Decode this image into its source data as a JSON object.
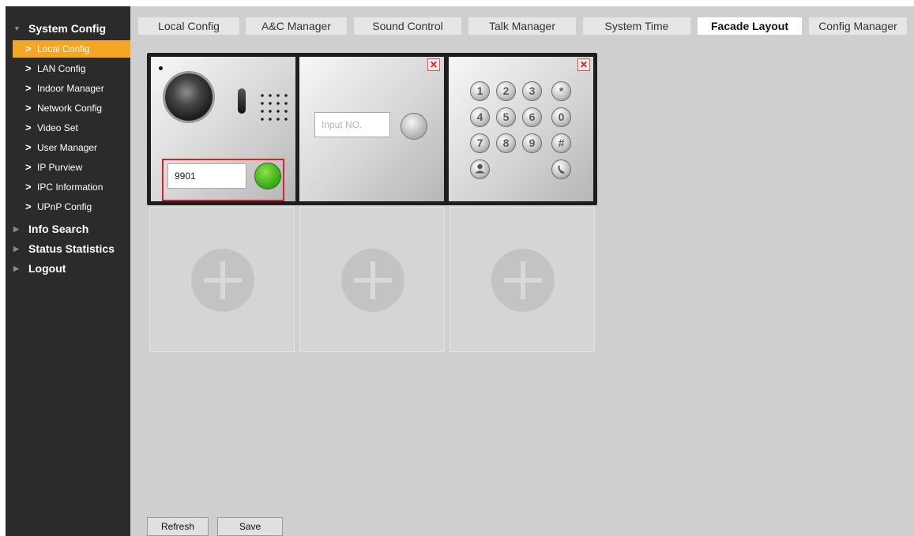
{
  "sidebar": {
    "system_config": "System Config",
    "items": [
      {
        "label": "Local Config"
      },
      {
        "label": "LAN Config"
      },
      {
        "label": "Indoor Manager"
      },
      {
        "label": "Network Config"
      },
      {
        "label": "Video Set"
      },
      {
        "label": "User Manager"
      },
      {
        "label": "IP Purview"
      },
      {
        "label": "IPC Information"
      },
      {
        "label": "UPnP Config"
      }
    ],
    "info_search": "Info Search",
    "status_statistics": "Status Statistics",
    "logout": "Logout",
    "active_item": "Local Config"
  },
  "tabs": [
    {
      "label": "Local Config"
    },
    {
      "label": "A&C Manager"
    },
    {
      "label": "Sound Control"
    },
    {
      "label": "Talk Manager"
    },
    {
      "label": "System Time"
    },
    {
      "label": "Facade Layout"
    },
    {
      "label": "Config Manager"
    }
  ],
  "active_tab": "Facade Layout",
  "facade": {
    "camera_module": {
      "number_value": "9901"
    },
    "button_module": {
      "input_placeholder": "Input NO."
    },
    "keypad_module": {
      "keys": [
        "1",
        "2",
        "3",
        "*",
        "4",
        "5",
        "6",
        "0",
        "7",
        "8",
        "9",
        "#"
      ],
      "icons": [
        "contact-icon",
        "phone-icon"
      ]
    },
    "close_symbol": "✕",
    "empty_slots": 3
  },
  "buttons": {
    "refresh": "Refresh",
    "save": "Save"
  },
  "colors": {
    "active_menu": "#f5a623",
    "sidebar_bg": "#2b2b2b",
    "highlight_frame": "#d6232a",
    "call_button": "#3db01a"
  }
}
